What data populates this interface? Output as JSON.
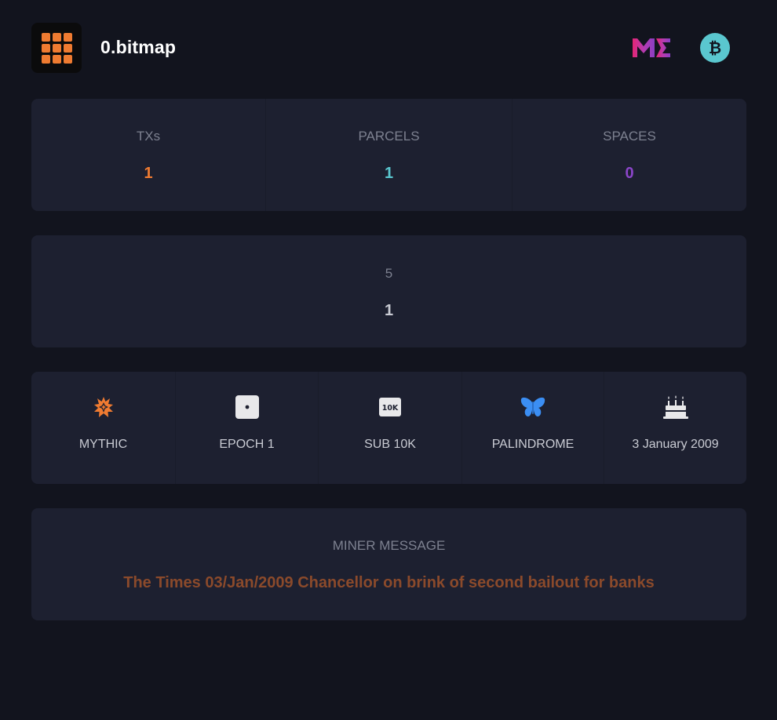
{
  "header": {
    "title": "0.bitmap",
    "logo_icon": "grid-icon",
    "magiceden_icon": "magic-eden-icon",
    "bitcoin_icon": "bitcoin-icon"
  },
  "stats": [
    {
      "label": "TXs",
      "value": "1",
      "color": "#ef7b31"
    },
    {
      "label": "PARCELS",
      "value": "1",
      "color": "#5ac7cf"
    },
    {
      "label": "SPACES",
      "value": "0",
      "color": "#8b45c9"
    }
  ],
  "parcel": {
    "label": "5",
    "value": "1"
  },
  "traits": [
    {
      "label": "MYTHIC",
      "icon": "mythic-icon"
    },
    {
      "label": "EPOCH 1",
      "icon": "dice-icon"
    },
    {
      "label": "SUB 10K",
      "icon": "10k-icon"
    },
    {
      "label": "PALINDROME",
      "icon": "butterfly-icon"
    },
    {
      "label": "3 January 2009",
      "icon": "birthday-cake-icon"
    }
  ],
  "miner": {
    "label": "MINER MESSAGE",
    "message": "The Times 03/Jan/2009 Chancellor on brink of second bailout for banks"
  },
  "colors": {
    "background": "#12141e",
    "card": "#1d2030",
    "accent": "#ef7b31",
    "teal": "#5ac7cf",
    "purple": "#8b45c9",
    "message": "#8b4a2b"
  }
}
